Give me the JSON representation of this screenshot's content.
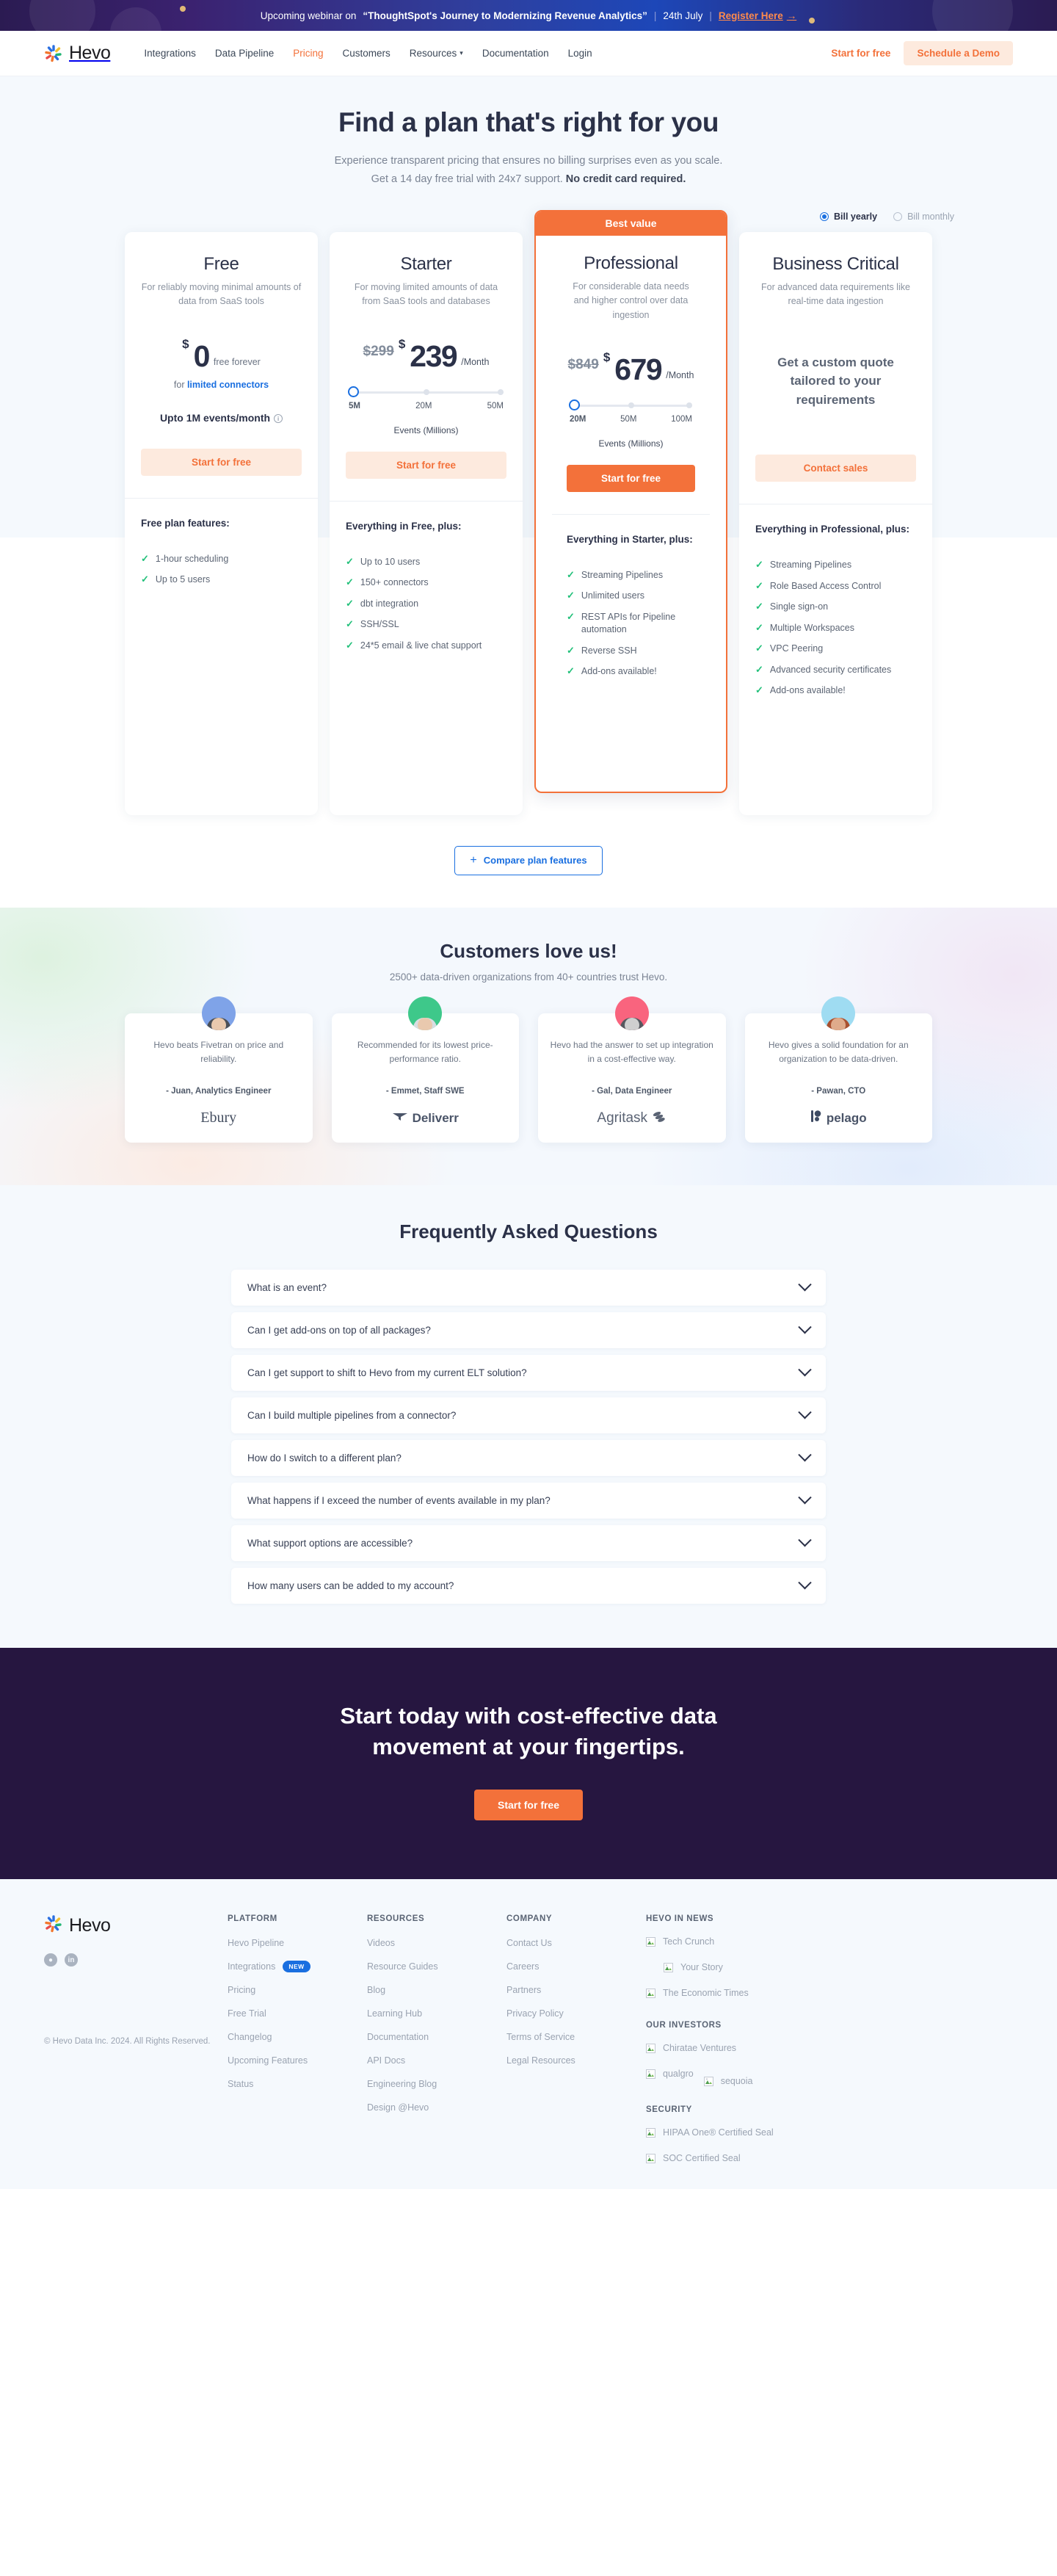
{
  "announcement": {
    "prefix": "Upcoming webinar on",
    "title": "“ThoughtSpot's Journey to Modernizing Revenue Analytics”",
    "date": "24th July",
    "cta": "Register Here",
    "arrow": "→"
  },
  "nav": {
    "brand": "Hevo",
    "links": [
      {
        "label": "Integrations",
        "active": false
      },
      {
        "label": "Data Pipeline",
        "active": false
      },
      {
        "label": "Pricing",
        "active": true
      },
      {
        "label": "Customers",
        "active": false
      },
      {
        "label": "Resources",
        "active": false,
        "caret": "⌄"
      },
      {
        "label": "Documentation",
        "active": false
      },
      {
        "label": "Login",
        "active": false
      }
    ],
    "start_free": "Start for free",
    "schedule_demo": "Schedule a Demo"
  },
  "hero": {
    "title": "Find a plan that's right for you",
    "line1": "Experience transparent pricing that ensures no billing surprises even as you scale.",
    "line2a": "Get a 14 day free trial with 24x7 support. ",
    "line2b": "No credit card required."
  },
  "billing": {
    "yearly": "Bill yearly",
    "monthly": "Bill monthly",
    "selected": "yearly"
  },
  "plans": [
    {
      "name": "Free",
      "desc": "For reliably moving minimal amounts of data from SaaS tools",
      "price_strike": "",
      "dollar": "$",
      "amount": "0",
      "suffix": "free forever",
      "sub_prefix": "for ",
      "sub_link": "limited connectors",
      "events_cap": "Upto 1M events/month",
      "cta": "Start for free",
      "cta_style": "soft",
      "features_title": "Free plan features:",
      "features": [
        "1-hour scheduling",
        "Up to 5 users"
      ]
    },
    {
      "name": "Starter",
      "desc": "For moving limited amounts of data from SaaS tools and databases",
      "price_strike": "$299",
      "dollar": "$",
      "amount": "239",
      "suffix": "/Month",
      "slider_ticks": [
        "5M",
        "20M",
        "50M"
      ],
      "slider_label": "Events (Millions)",
      "cta": "Start for free",
      "cta_style": "soft",
      "features_title": "Everything in Free, plus:",
      "features": [
        "Up to 10 users",
        "150+ connectors",
        "dbt integration",
        "SSH/SSL",
        "24*5 email & live chat support"
      ]
    },
    {
      "name": "Professional",
      "badge": "Best value",
      "desc": "For considerable data needs and higher control over data ingestion",
      "price_strike": "$849",
      "dollar": "$",
      "amount": "679",
      "suffix": "/Month",
      "slider_ticks": [
        "20M",
        "50M",
        "100M"
      ],
      "slider_label": "Events (Millions)",
      "cta": "Start for free",
      "cta_style": "solid",
      "features_title": "Everything in Starter, plus:",
      "features": [
        "Streaming Pipelines",
        "Unlimited users",
        "REST APIs for Pipeline automation",
        "Reverse SSH",
        "Add-ons available!"
      ]
    },
    {
      "name": "Business Critical",
      "desc": "For advanced data requirements like real-time data ingestion",
      "custom_quote": "Get a custom quote tailored to your requirements",
      "cta": "Contact sales",
      "cta_style": "soft",
      "features_title": "Everything in Professional, plus:",
      "features": [
        "Streaming Pipelines",
        "Role Based Access Control",
        "Single sign-on",
        "Multiple Workspaces",
        "VPC Peering",
        "Advanced security certificates",
        "Add-ons available!"
      ]
    }
  ],
  "compare": {
    "label": "Compare plan features",
    "plus": "+"
  },
  "customers": {
    "title": "Customers love us!",
    "subtitle": "2500+ data-driven organizations from 40+ countries trust Hevo.",
    "testimonials": [
      {
        "quote": "Hevo beats Fivetran on price and reliability.",
        "author": "- Juan, Analytics Engineer",
        "company": "Ebury",
        "logo_style": "serif",
        "avatar_bg": "#7fa3e8"
      },
      {
        "quote": "Recommended for its lowest price-performance ratio.",
        "author": "- Emmet, Staff SWE",
        "company": "Deliverr",
        "logo_style": "bold",
        "avatar_bg": "#3ec88a"
      },
      {
        "quote": "Hevo had the answer to set up integration in a cost-effective way.",
        "author": "- Gal, Data Engineer",
        "company": "Agritask",
        "logo_style": "thin",
        "avatar_bg": "#f9647e"
      },
      {
        "quote": "Hevo gives a solid foundation for an organization to be data-driven.",
        "author": "- Pawan, CTO",
        "company": "pelago",
        "logo_style": "bold",
        "avatar_bg": "#9fdcf2"
      }
    ]
  },
  "faq": {
    "title": "Frequently Asked Questions",
    "items": [
      "What is an event?",
      "Can I get add-ons on top of all packages?",
      "Can I get support to shift to Hevo from my current ELT solution?",
      "Can I build multiple pipelines from a connector?",
      "How do I switch to a different plan?",
      "What happens if I exceed the number of events available in my plan?",
      "What support options are accessible?",
      "How many users can be added to my account?"
    ]
  },
  "cta_band": {
    "line1": "Start today with cost-effective data",
    "line2": "movement at your fingertips.",
    "button": "Start for free"
  },
  "footer": {
    "brand": "Hevo",
    "social": [
      {
        "name": "twitter",
        "glyph": "✉"
      },
      {
        "name": "linkedin",
        "glyph": "in"
      }
    ],
    "columns": [
      {
        "title": "PLATFORM",
        "links": [
          {
            "label": "Hevo Pipeline"
          },
          {
            "label": "Integrations",
            "badge": "NEW"
          },
          {
            "label": "Pricing"
          },
          {
            "label": "Free Trial"
          },
          {
            "label": "Changelog"
          },
          {
            "label": "Upcoming Features"
          },
          {
            "label": "Status"
          }
        ]
      },
      {
        "title": "RESOURCES",
        "links": [
          {
            "label": "Videos"
          },
          {
            "label": "Resource Guides"
          },
          {
            "label": "Blog"
          },
          {
            "label": "Learning Hub"
          },
          {
            "label": "Documentation"
          },
          {
            "label": "API Docs"
          },
          {
            "label": "Engineering Blog"
          },
          {
            "label": "Design @Hevo"
          }
        ]
      },
      {
        "title": "COMPANY",
        "links": [
          {
            "label": "Contact Us"
          },
          {
            "label": "Careers"
          },
          {
            "label": "Partners"
          },
          {
            "label": "Privacy Policy"
          },
          {
            "label": "Terms of Service"
          },
          {
            "label": "Legal Resources"
          }
        ]
      }
    ],
    "news": {
      "title": "HEVO IN NEWS",
      "items": [
        "Tech Crunch",
        "Your Story",
        "The Economic Times"
      ]
    },
    "investors": {
      "title": "OUR INVESTORS",
      "items": [
        "Chiratae Ventures",
        "qualgro",
        "sequoia"
      ]
    },
    "security": {
      "title": "SECURITY",
      "items": [
        "HIPAA One® Certified Seal",
        "SOC Certified Seal"
      ]
    },
    "copyright": "© Hevo Data Inc. 2024. All Rights Reserved."
  },
  "colors": {
    "accent": "#f3713a",
    "link": "#1a6fe0",
    "check": "#22c07a",
    "dark": "#261640"
  }
}
